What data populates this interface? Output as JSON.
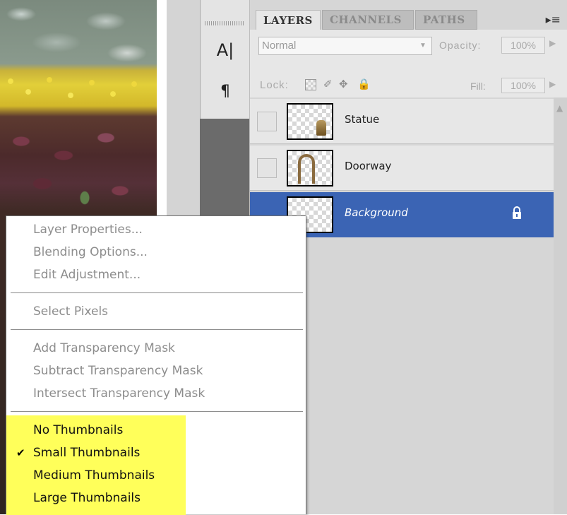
{
  "tabs": {
    "layers": "LAYERS",
    "channels": "CHANNELS",
    "paths": "PATHS"
  },
  "options": {
    "blend_mode": "Normal",
    "opacity_label": "Opacity:",
    "opacity_value": "100%",
    "lock_label": "Lock:",
    "fill_label": "Fill:",
    "fill_value": "100%"
  },
  "layers": [
    {
      "name": "Statue",
      "visible": false,
      "selected": false
    },
    {
      "name": "Doorway",
      "visible": false,
      "selected": false
    },
    {
      "name": "Background",
      "visible": true,
      "selected": true,
      "locked": true
    }
  ],
  "context_menu": {
    "items": [
      {
        "label": "Layer Properties...",
        "enabled": false
      },
      {
        "label": "Blending Options...",
        "enabled": false
      },
      {
        "label": "Edit Adjustment...",
        "enabled": false
      },
      {
        "label": "Select Pixels",
        "enabled": false
      },
      {
        "label": "Add Transparency Mask",
        "enabled": false
      },
      {
        "label": "Subtract Transparency Mask",
        "enabled": false
      },
      {
        "label": "Intersect Transparency Mask",
        "enabled": false
      },
      {
        "label": "No Thumbnails",
        "enabled": true,
        "checked": false
      },
      {
        "label": "Small Thumbnails",
        "enabled": true,
        "checked": true
      },
      {
        "label": "Medium Thumbnails",
        "enabled": true,
        "checked": false
      },
      {
        "label": "Large Thumbnails",
        "enabled": true,
        "checked": false
      }
    ],
    "highlight_color": "#ffff5a"
  },
  "colors": {
    "selection": "#3b64b4",
    "panel_bg": "#d6d6d6"
  },
  "icons": {
    "char": "A|",
    "paragraph": "¶",
    "panel_menu": "▸≡",
    "check": "✔"
  }
}
